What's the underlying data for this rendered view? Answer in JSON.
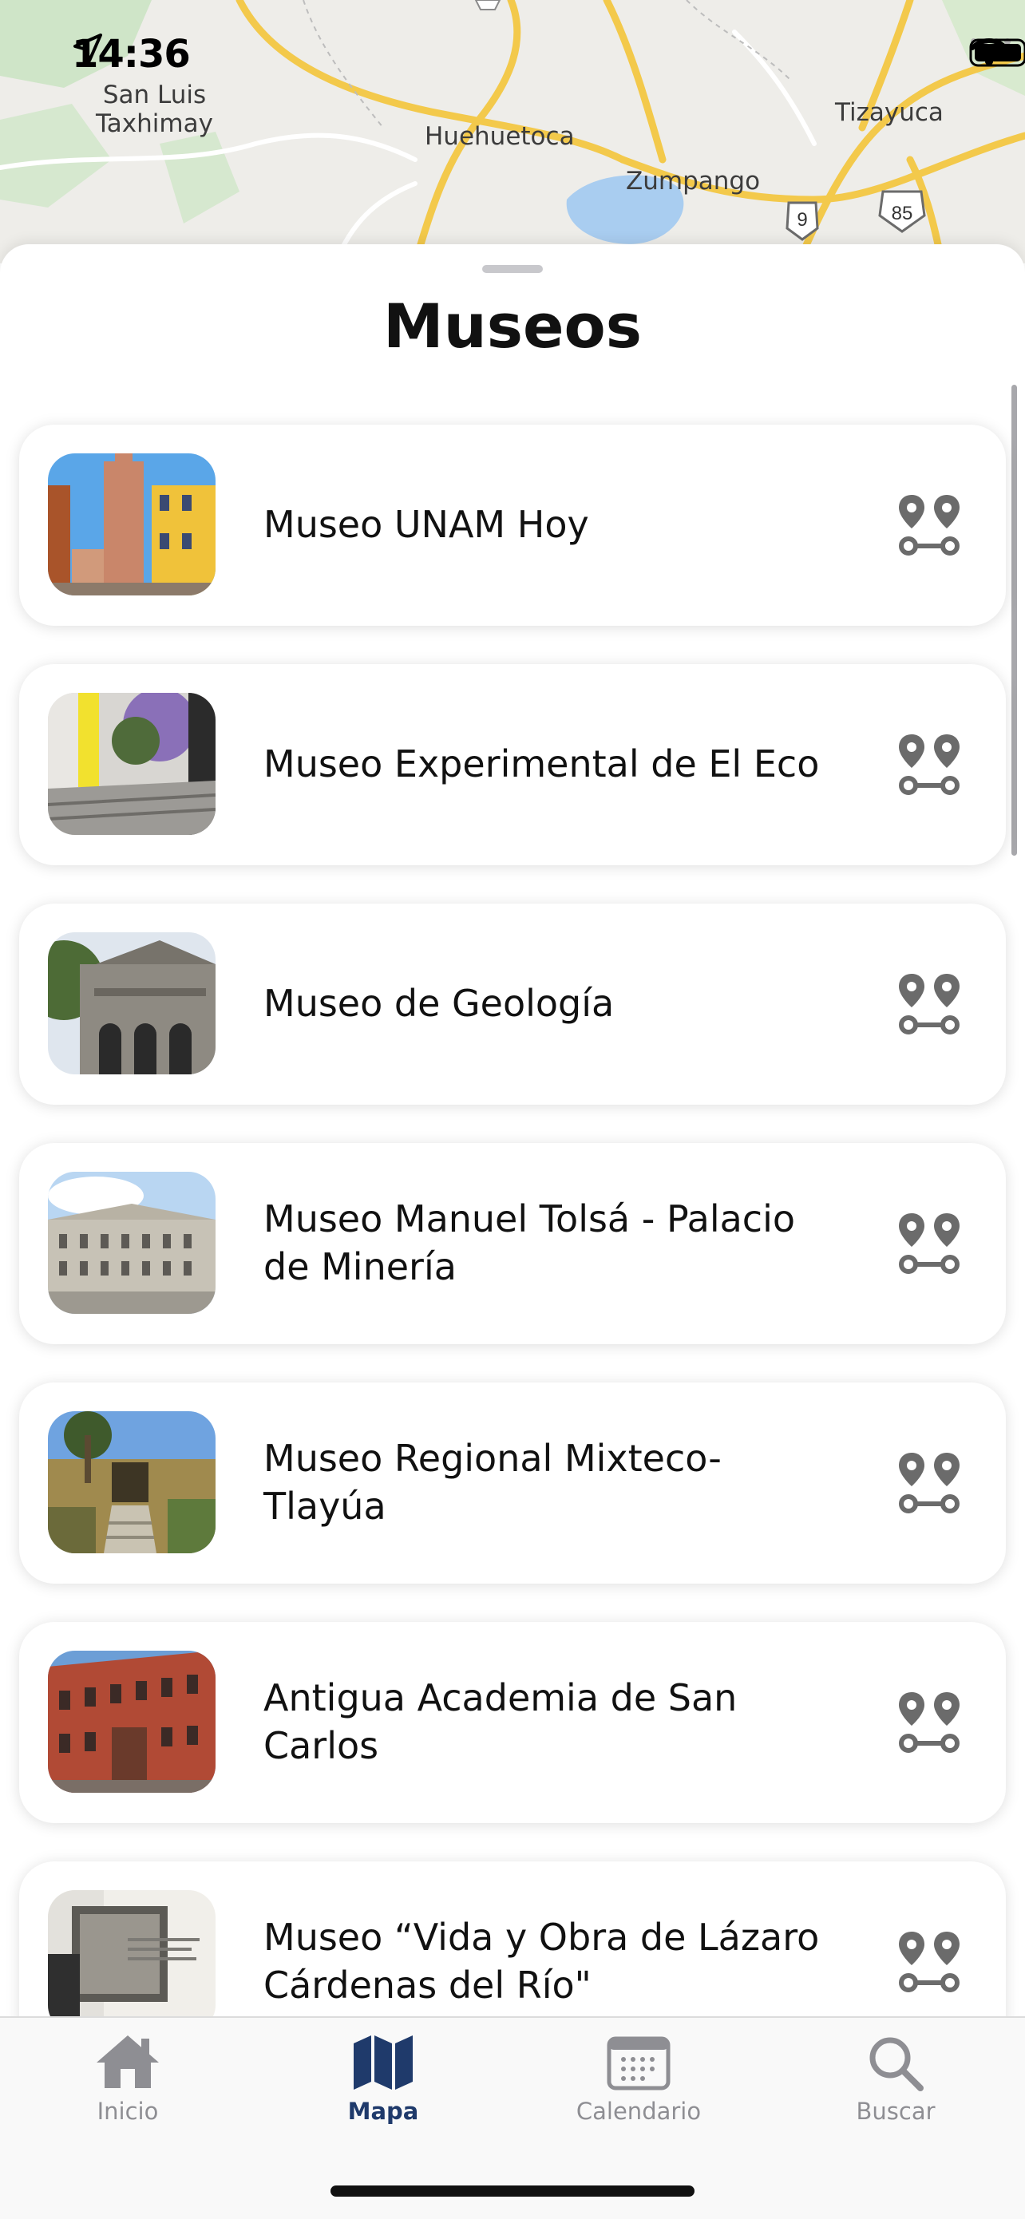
{
  "status_bar": {
    "time": "14:36"
  },
  "map": {
    "labels": [
      {
        "text": "San Luis\nTaxhimay"
      },
      {
        "text": "Huehuetoca"
      },
      {
        "text": "Tizayuca"
      },
      {
        "text": "Zumpango"
      }
    ],
    "route_shields": [
      "9",
      "85"
    ]
  },
  "sheet": {
    "title": "Museos",
    "items": [
      {
        "title": "Museo UNAM Hoy"
      },
      {
        "title": "Museo Experimental de El Eco"
      },
      {
        "title": "Museo de Geología"
      },
      {
        "title": "Museo Manuel Tolsá - Palacio de Minería"
      },
      {
        "title": "Museo Regional Mixteco-Tlayúa"
      },
      {
        "title": "Antigua Academia de San Carlos"
      },
      {
        "title": "Museo “Vida y Obra de Lázaro Cárdenas del Río\""
      }
    ]
  },
  "tab_bar": {
    "tabs": [
      {
        "label": "Inicio",
        "icon": "home-icon",
        "active": false
      },
      {
        "label": "Mapa",
        "icon": "map-icon",
        "active": true
      },
      {
        "label": "Calendario",
        "icon": "calendar-icon",
        "active": false
      },
      {
        "label": "Buscar",
        "icon": "search-icon",
        "active": false
      }
    ]
  },
  "colors": {
    "accent": "#1f3a6b",
    "inactive": "#8e8e93",
    "route_icon": "#6b6b6b",
    "map_road": "#f3c94b",
    "map_water": "#a9cdf0"
  }
}
